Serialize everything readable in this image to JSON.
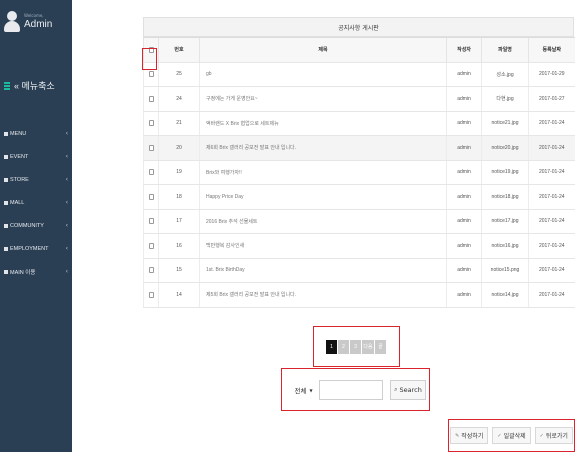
{
  "sidebar": {
    "welcome": "Welcome,",
    "admin_name": "Admin",
    "menu_title": "« 메뉴축소",
    "items": [
      {
        "label": "MENU"
      },
      {
        "label": "EVENT"
      },
      {
        "label": "STORE"
      },
      {
        "label": "MALL"
      },
      {
        "label": "COMMUNITY"
      },
      {
        "label": "EMPLOYMENT"
      },
      {
        "label": "MAIN 이용"
      }
    ],
    "chevron": "‹"
  },
  "board": {
    "title": "공지사항 게시판",
    "columns": {
      "number": "번호",
      "subject": "제목",
      "author": "작성자",
      "file": "파일명",
      "date": "등록날짜"
    },
    "rows": [
      {
        "number": "25",
        "subject": "gb",
        "author": "admin",
        "file": "성소.jpg",
        "date": "2017-01-29"
      },
      {
        "number": "24",
        "subject": "구정에는 가게 운영안요~",
        "author": "admin",
        "file": "다현.jpg",
        "date": "2017-01-27"
      },
      {
        "number": "21",
        "subject": "액바랜드 X Brix 협업으로 세트제뉴",
        "author": "admin",
        "file": "notice21.jpg",
        "date": "2017-01-24"
      },
      {
        "number": "20",
        "subject": "제6회 Brix 갤러리 공모전 발표 안내 입니다.",
        "author": "admin",
        "file": "notice20.jpg",
        "date": "2017-01-24"
      },
      {
        "number": "19",
        "subject": "Brix와 여행가자!!",
        "author": "admin",
        "file": "notice19.jpg",
        "date": "2017-01-24"
      },
      {
        "number": "18",
        "subject": "Happy Price Day",
        "author": "admin",
        "file": "notice18.jpg",
        "date": "2017-01-24"
      },
      {
        "number": "17",
        "subject": "2016 Brix 추석 선물세트",
        "author": "admin",
        "file": "notice17.jpg",
        "date": "2017-01-24"
      },
      {
        "number": "16",
        "subject": "백만행복 감사인새",
        "author": "admin",
        "file": "notice16.jpg",
        "date": "2017-01-24"
      },
      {
        "number": "15",
        "subject": "1st. Brix BirthDay",
        "author": "admin",
        "file": "notice15.png",
        "date": "2017-01-24"
      },
      {
        "number": "14",
        "subject": "제5회 Brix 갤러리 공모전 발표 안내 입니다.",
        "author": "admin",
        "file": "notice14.jpg",
        "date": "2017-01-24"
      }
    ]
  },
  "pagination": {
    "pages": [
      "1",
      "2",
      "3"
    ],
    "next": "다음",
    "last": "끝"
  },
  "search": {
    "select_value": "전체",
    "input_value": "",
    "button_label": "Search"
  },
  "actions": {
    "write": "작성하기",
    "delete_all": "일괄삭제",
    "back": "뒤로가기"
  },
  "colors": {
    "sidebar_bg": "#2a3f54",
    "accent": "#1abb9c",
    "highlight_border": "#d9232d",
    "active_page": "#111111"
  }
}
